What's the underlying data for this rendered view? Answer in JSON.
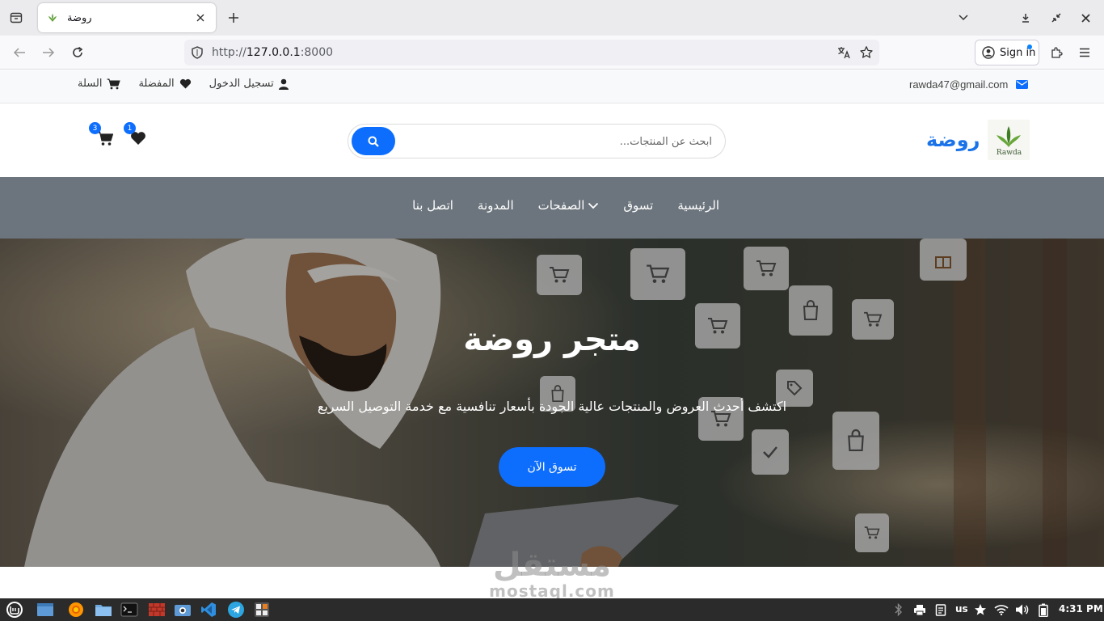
{
  "browser": {
    "tab_title": "روضة",
    "url_scheme": "http://",
    "url_host": "127.0.0.1",
    "url_port": ":8000",
    "signin_label": "Sign in"
  },
  "topbar": {
    "email": "rawda47@gmail.com",
    "login_label": "تسجيل الدخول",
    "favorites_label": "المفضلة",
    "cart_label": "السلة"
  },
  "header": {
    "brand_name": "روضة",
    "logo_text": "Rawda",
    "search_placeholder": "ابحث عن المنتجات...",
    "wishlist_count": "1",
    "cart_count": "3"
  },
  "nav": {
    "items": [
      "الرئيسية",
      "تسوق",
      "الصفحات",
      "المدونة",
      "اتصل بنا"
    ]
  },
  "hero": {
    "title": "متجر روضة",
    "subtitle": "اكتشف أحدث العروض والمنتجات عالية الجودة بأسعار تنافسية مع خدمة التوصيل السريع",
    "button_label": "تسوق الآن"
  },
  "watermark": {
    "arabic": "مستقل",
    "latin": "mostaql.com"
  },
  "taskbar": {
    "keyboard_layout": "us",
    "clock": "4:31 PM"
  },
  "colors": {
    "primary": "#0d6efd",
    "brand": "#1a73e8",
    "nav_bg": "#6c757d"
  }
}
